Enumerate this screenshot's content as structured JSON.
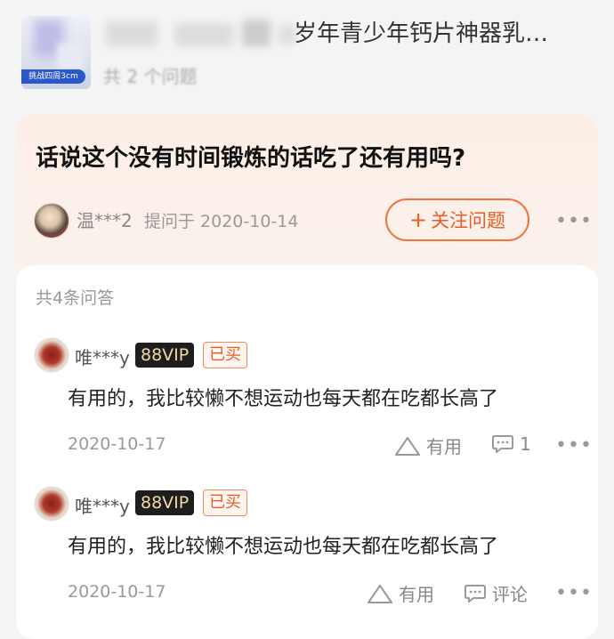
{
  "header": {
    "thumbnail_tag": "挑战四周3cm",
    "title": "岁年青少年钙片神器乳…",
    "subtitle": "共 2 个问题"
  },
  "question": {
    "text": "话说这个没有时间锻炼的话吃了还有用吗?",
    "asker": "温***2",
    "asked_date": "提问于 2020-10-14",
    "follow_plus": "+",
    "follow_label": "关注问题",
    "more_icon": "•••"
  },
  "answers_section": {
    "count_label": "共4条问答",
    "answers": [
      {
        "user": "唯***y",
        "vip_badge": "88VIP",
        "bought_badge": "已买",
        "text": "有用的，我比较懒不想运动也每天都在吃都长高了",
        "date": "2020-10-17",
        "useful_label": "有用",
        "comment_label": "1",
        "more_icon": "•••"
      },
      {
        "user": "唯***y",
        "vip_badge": "88VIP",
        "bought_badge": "已买",
        "text": "有用的，我比较懒不想运动也每天都在吃都长高了",
        "date": "2020-10-17",
        "useful_label": "有用",
        "comment_label": "评论",
        "more_icon": "•••"
      }
    ]
  },
  "colors": {
    "accent": "#ec5c22",
    "card_bg": "#fbeee6",
    "vip_bg": "#1e1e1e",
    "vip_text": "#f2d9a6"
  }
}
